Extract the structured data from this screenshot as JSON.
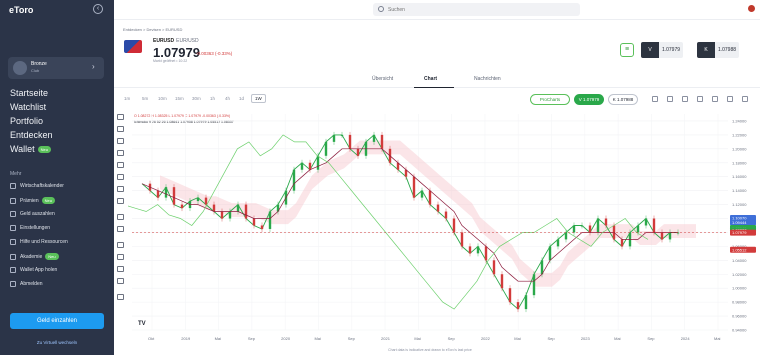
{
  "brand": {
    "logo": "eToro"
  },
  "sidebar": {
    "profile": {
      "name": "Bronze",
      "club": "Club"
    },
    "main_items": [
      {
        "label": "Startseite"
      },
      {
        "label": "Watchlist"
      },
      {
        "label": "Portfolio"
      },
      {
        "label": "Entdecken"
      },
      {
        "label": "Wallet",
        "badge": "Neu"
      }
    ],
    "more_label": "Mehr",
    "more_items": [
      {
        "label": "Wirtschaftskalender"
      },
      {
        "label": "Prämien",
        "badge": "Neu"
      },
      {
        "label": "Geld auszahlen"
      },
      {
        "label": "Einstellungen"
      },
      {
        "label": "Hilfe und Ressourcen"
      },
      {
        "label": "Akademie",
        "badge": "Neu"
      },
      {
        "label": "Wallet App holen"
      },
      {
        "label": "Abmelden"
      }
    ],
    "deposit_label": "Geld einzahlen",
    "virtual_label": "Zu Virtuell wechseln"
  },
  "topbar": {
    "search_placeholder": "Suchen"
  },
  "instrument": {
    "breadcrumb": "Entdecken   >   Devisen   >   EURUSD",
    "symbol": "EURUSD",
    "name": "EUR/USD",
    "price": "1.07979",
    "change": "-0.00363 (-0.33%)",
    "market_status": "Markt geöffnet  •  10:22"
  },
  "trade": {
    "sell_label": "V",
    "sell_price": "1.07979",
    "buy_label": "K",
    "buy_price": "1.07988"
  },
  "tabs": [
    {
      "label": "Übersicht"
    },
    {
      "label": "Chart"
    },
    {
      "label": "Nachrichten"
    }
  ],
  "chart_toolbar": {
    "timeframes": [
      "1m",
      "5m",
      "10m",
      "15m",
      "30m",
      "1h",
      "4h",
      "1d",
      "1W"
    ],
    "active_timeframe": "1W",
    "prochart_label": "ProCharts",
    "sell_pill": "V 1.07979",
    "buy_pill": "K 1.07988"
  },
  "chart_legend": {
    "ohlc": "O 1.08272  H 1.08325  L 1.07979  C 1.07979  -0.00363 (-0.33%)",
    "indicator": "Ichimoku  9 26 52 26  1.08641  1.07958  1.07979  1.05512  1.08337"
  },
  "chart_data": {
    "type": "line",
    "title": "EURUSD",
    "x_tick_labels": [
      "Okt",
      "2019",
      "Mai",
      "Sep",
      "2020",
      "Mai",
      "Sep",
      "2021",
      "Mai",
      "Sep",
      "2022",
      "Mai",
      "Sep",
      "2023",
      "Mai",
      "Sep",
      "2024",
      "Mai"
    ],
    "y_tick_labels": [
      "1.24000",
      "1.22000",
      "1.20000",
      "1.18000",
      "1.16000",
      "1.14000",
      "1.12000",
      "1.10000",
      "1.08000",
      "1.06000",
      "1.04000",
      "1.02000",
      "1.00000",
      "0.98000",
      "0.96000",
      "0.94000"
    ],
    "ylim": [
      0.94,
      1.25
    ],
    "series": [
      {
        "name": "Kurs",
        "color": "#2aa84a",
        "values": [
          1.15,
          1.14,
          1.13,
          1.145,
          1.12,
          1.115,
          1.125,
          1.13,
          1.12,
          1.11,
          1.1,
          1.11,
          1.12,
          1.1,
          1.09,
          1.085,
          1.11,
          1.12,
          1.14,
          1.17,
          1.18,
          1.17,
          1.19,
          1.21,
          1.22,
          1.22,
          1.2,
          1.19,
          1.21,
          1.22,
          1.2,
          1.18,
          1.17,
          1.16,
          1.13,
          1.14,
          1.12,
          1.11,
          1.1,
          1.08,
          1.06,
          1.05,
          1.06,
          1.04,
          1.02,
          1.0,
          0.98,
          0.97,
          0.99,
          1.02,
          1.04,
          1.06,
          1.07,
          1.08,
          1.09,
          1.09,
          1.08,
          1.1,
          1.09,
          1.07,
          1.06,
          1.08,
          1.09,
          1.1,
          1.08,
          1.07,
          1.08,
          1.08
        ]
      },
      {
        "name": "Kijun",
        "color": "#8b1a3b",
        "values": [
          1.15,
          1.145,
          1.14,
          1.135,
          1.13,
          1.125,
          1.12,
          1.12,
          1.115,
          1.11,
          1.11,
          1.11,
          1.11,
          1.105,
          1.1,
          1.1,
          1.1,
          1.11,
          1.13,
          1.15,
          1.16,
          1.17,
          1.175,
          1.18,
          1.19,
          1.2,
          1.2,
          1.2,
          1.2,
          1.2,
          1.2,
          1.19,
          1.18,
          1.17,
          1.16,
          1.15,
          1.14,
          1.13,
          1.12,
          1.11,
          1.09,
          1.08,
          1.07,
          1.06,
          1.05,
          1.03,
          1.02,
          1.01,
          1.01,
          1.01,
          1.02,
          1.04,
          1.05,
          1.06,
          1.07,
          1.08,
          1.08,
          1.08,
          1.08,
          1.08,
          1.07,
          1.07,
          1.07,
          1.08,
          1.08,
          1.08,
          1.08,
          1.08
        ]
      },
      {
        "name": "Chikou",
        "color": "#6dd06d",
        "values": [
          1.13,
          1.12,
          1.115,
          1.11,
          1.12,
          1.105,
          1.1,
          1.09,
          1.11,
          1.14,
          1.17,
          1.2,
          1.21,
          1.19,
          1.2,
          1.22,
          1.21,
          1.21,
          1.19,
          1.18,
          1.16,
          1.14,
          1.12,
          1.1,
          1.08,
          1.06,
          1.04,
          1.02,
          1.0,
          0.98,
          0.97,
          0.99,
          1.01,
          1.04,
          1.06,
          1.07,
          1.08,
          1.08,
          1.09,
          1.1,
          1.08,
          1.07,
          1.06,
          1.08,
          1.09,
          1.1,
          1.08,
          1.07
        ]
      }
    ],
    "grid": true
  },
  "footer": {
    "note": "Chart data is indicative and drawn to eToro's last price"
  },
  "price_tags": [
    {
      "label": "1.10070",
      "color": "#3f6fd8"
    },
    {
      "label": "1.09444",
      "color": "#3f6fd8"
    },
    {
      "label": "1.08641",
      "color": "#2aa84a"
    },
    {
      "label": "1.08337",
      "color": "#2aa84a"
    },
    {
      "label": "1.07979",
      "color": "#d23b3b"
    },
    {
      "label": "1.05512",
      "color": "#d23b3b"
    }
  ]
}
